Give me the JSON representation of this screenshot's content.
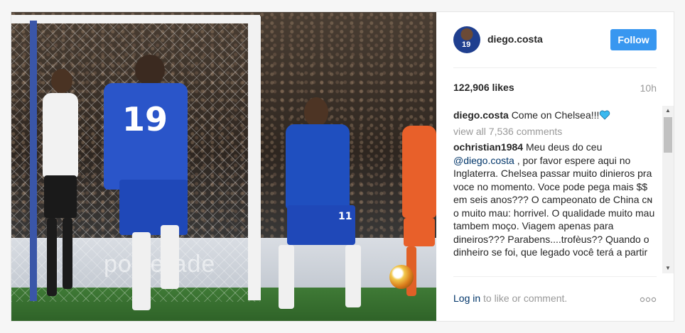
{
  "post": {
    "photo": {
      "board_text": "powerade"
    },
    "header": {
      "username": "diego.costa",
      "avatar_number": "19",
      "follow_label": "Follow"
    },
    "stats": {
      "likes": "122,906 likes",
      "time": "10h"
    },
    "caption": {
      "username": "diego.costa",
      "text": "Come on Chelsea!!!",
      "emoji": "blue-heart-icon"
    },
    "view_all": "view all 7,536 comments",
    "comment": {
      "username": "ochristian1984",
      "text_before": "Meu deus do ceu",
      "mention": "@diego.costa",
      "text_after": ", por favor espere aqui no Inglaterra. Chelsea passar muito dinieros pra voce no momento. Voce pode pega mais $$ em seis anos??? O campeonato de China ᴄɴ o muito mau: horrivel. O qualidade muito mau tambem moço. Viagem apenas para dineiros??? Parabens....trofèus?? Quando o dinheiro se foi, que legado você terá a partir"
    },
    "footer": {
      "login_link": "Log in",
      "login_text": "to like or comment."
    },
    "shirt_numbers": {
      "costa": "19",
      "pedro": "11"
    },
    "colors": {
      "follow_blue": "#3897f0",
      "link_blue": "#003569",
      "chelsea_blue": "#1f4fbf",
      "heart": "#3bb9f0"
    }
  }
}
